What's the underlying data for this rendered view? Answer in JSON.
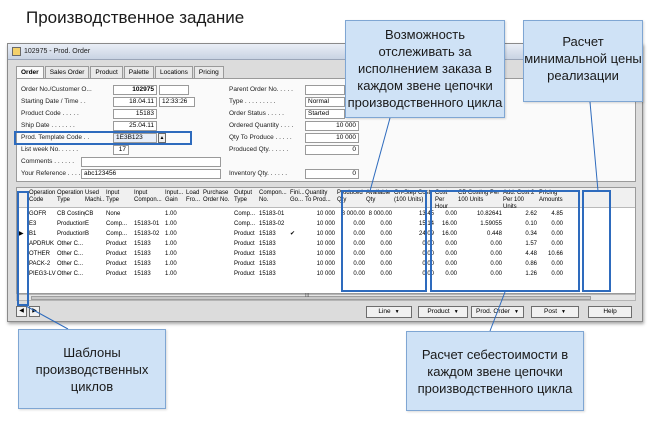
{
  "slide_title": "Производственное задание",
  "window": {
    "title": "102975 - Prod. Order",
    "icon": "document-icon"
  },
  "tabs": [
    "Order",
    "Sales Order",
    "Product",
    "Palette",
    "Locations",
    "Pricing"
  ],
  "form": {
    "left": [
      {
        "label": "Order No./Customer O...",
        "value": "102975",
        "extra": ""
      },
      {
        "label": "Starting Date / Time . .",
        "value": "18.04.11",
        "extra": "12:33:26"
      },
      {
        "label": "Product Code . . . . .",
        "value": "15183",
        "extra": ""
      },
      {
        "label": "Ship Date . . . . . . .",
        "value": "25.04.11",
        "extra": ""
      },
      {
        "label": "Prod. Template Code . .",
        "value": "1E3B123",
        "extra": ""
      },
      {
        "label": "List week No. . . . . .",
        "value": "17",
        "extra": ""
      },
      {
        "label": "Comments . . . . . .",
        "value": "",
        "extra": ""
      },
      {
        "label": "Your Reference . . . . .",
        "value": "abc123456",
        "extra": ""
      }
    ],
    "right": [
      {
        "label": "Parent Order No. . . . .",
        "value": ""
      },
      {
        "label": "Type . . . . . . . . .",
        "value": "Normal"
      },
      {
        "label": "Order Status . . . . .",
        "value": "Started"
      },
      {
        "label": "Ordered Quantity . . . .",
        "value": "10 000"
      },
      {
        "label": "Qty To Produce . . . . .",
        "value": "10 000"
      },
      {
        "label": "Produced Qty. . . . . .",
        "value": "0"
      },
      {
        "label": "Inventory Qty. . . . . .",
        "value": "0"
      }
    ]
  },
  "grid": {
    "headers": [
      "Operation Code",
      "Operation Type",
      "Used Machi...",
      "Input Type",
      "Input Compon...",
      "Input... Gain",
      "Load Fro...",
      "Purchase Order No.",
      "Output Type",
      "Compon... No.",
      "Fini... Go...",
      "Quantity To Prod...",
      "Produced Qty",
      "Available Qty",
      "On-Step Cost (100 Units)",
      "Cost Per Hour",
      "CB Costing Per 100 Units",
      "Add. Cost 2 Per 100 Units",
      "Pricing Amounts"
    ],
    "rows": [
      [
        "GOFR",
        "CB Costing",
        "CB",
        "None",
        "",
        "1.00",
        "",
        "",
        "Comp...",
        "15183-01",
        "",
        "10 000",
        "8 000.00",
        "8 000.00",
        "13.45",
        "0.00",
        "10.82641",
        "2.62",
        "4.85"
      ],
      [
        "E3",
        "Production",
        "E",
        "Comp...",
        "15183-01",
        "1.00",
        "",
        "",
        "Comp...",
        "15183-02",
        "",
        "10 000",
        "0.00",
        "0.00",
        "15.14",
        "16.00",
        "1.59055",
        "0.10",
        "0.00"
      ],
      [
        "B1",
        "Production",
        "B",
        "Comp...",
        "15183-02",
        "1.00",
        "",
        "",
        "Product",
        "15183",
        "✔",
        "10 000",
        "0.00",
        "0.00",
        "24.09",
        "16.00",
        "0.448",
        "0.34",
        "0.00"
      ],
      [
        "APDRUK",
        "Other C...",
        "",
        "Product",
        "15183",
        "1.00",
        "",
        "",
        "Product",
        "15183",
        "",
        "10 000",
        "0.00",
        "0.00",
        "0.00",
        "0.00",
        "0.00",
        "1.57",
        "0.00"
      ],
      [
        "OTHER",
        "Other C...",
        "",
        "Product",
        "15183",
        "1.00",
        "",
        "",
        "Product",
        "15183",
        "",
        "10 000",
        "0.00",
        "0.00",
        "0.00",
        "0.00",
        "0.00",
        "4.48",
        "10.66"
      ],
      [
        "PACK-2",
        "Other C...",
        "",
        "Product",
        "15183",
        "1.00",
        "",
        "",
        "Product",
        "15183",
        "",
        "10 000",
        "0.00",
        "0.00",
        "0.00",
        "0.00",
        "0.00",
        "0.86",
        "0.00"
      ],
      [
        "PIEG3-LV",
        "Other C...",
        "",
        "Product",
        "15183",
        "1.00",
        "",
        "",
        "Product",
        "15183",
        "",
        "10 000",
        "0.00",
        "0.00",
        "0.00",
        "0.00",
        "0.00",
        "1.26",
        "0.00"
      ]
    ],
    "scroll_label": "III"
  },
  "buttons": {
    "line": "Line",
    "product": "Product",
    "prod_order": "Prod. Order",
    "post": "Post",
    "help": "Help"
  },
  "callouts": {
    "tracking": "Возможность отслеживать за исполнением заказа в каждом звене цепочки производственного цикла",
    "min_price": "Расчет минимальной цены реализации",
    "templates": "Шаблоны производственных циклов",
    "cost_calc": "Расчет себестоимости в каждом звене цепочки производственного цикла"
  },
  "colors": {
    "callout_fill": "#cfe2f6",
    "callout_border": "#7fa6d3",
    "highlight": "#2e6bbd"
  }
}
